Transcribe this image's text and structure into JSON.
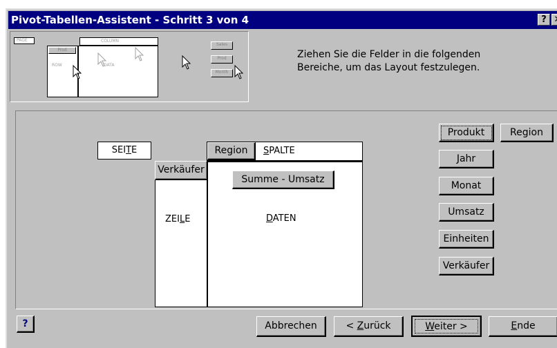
{
  "window": {
    "title": "Pivot-Tabellen-Assistent - Schritt 3 von 4",
    "help_glyph": "?",
    "close_glyph": "✕"
  },
  "preview": {
    "page": "PAGE",
    "col": "COLUMN",
    "row_field": "Prod",
    "row": "ROW",
    "data": "DATA",
    "btn1": "Sales",
    "btn2": "Prod",
    "btn3": "Month"
  },
  "instructions": "Ziehen Sie die Felder in die folgenden Bereiche, um das Layout festzulegen.",
  "layout": {
    "page_label_pre": "SEI",
    "page_label_ul": "T",
    "page_label_post": "E",
    "column_field": "Region",
    "column_label_pre": "",
    "column_label_ul": "S",
    "column_label_post": "PALTE",
    "row_field": "Verkäufer",
    "row_label_pre": "ZEI",
    "row_label_ul": "L",
    "row_label_post": "E",
    "data_field": "Summe - Umsatz",
    "data_label_pre": "",
    "data_label_ul": "D",
    "data_label_post": "ATEN"
  },
  "fields": {
    "produkt": "Produkt",
    "region": "Region",
    "jahr": "Jahr",
    "monat": "Monat",
    "umsatz": "Umsatz",
    "einheiten": "Einheiten",
    "verkaeufer": "Verkäufer"
  },
  "footer": {
    "help_glyph": "?",
    "cancel": "Abbrechen",
    "back_pre": "< ",
    "back_ul": "Z",
    "back_post": "urück",
    "next_pre": "",
    "next_ul": "W",
    "next_post": "eiter >",
    "finish_pre": "",
    "finish_ul": "E",
    "finish_post": "nde"
  }
}
